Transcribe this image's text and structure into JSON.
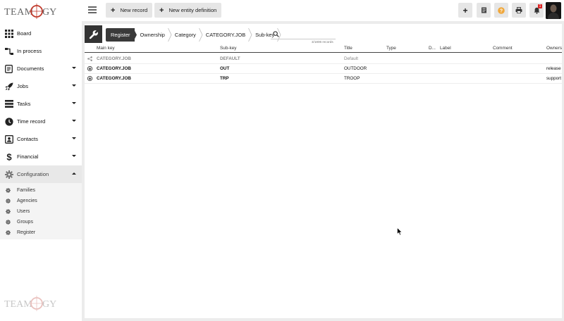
{
  "sidebar": {
    "items": [
      {
        "label": "Board",
        "icon": "grid-icon",
        "caret": ""
      },
      {
        "label": "In process",
        "icon": "flow-icon",
        "caret": ""
      },
      {
        "label": "Documents",
        "icon": "document-icon",
        "caret": "down"
      },
      {
        "label": "Jobs",
        "icon": "rocket-icon",
        "caret": "down"
      },
      {
        "label": "Tasks",
        "icon": "tasks-icon",
        "caret": "down"
      },
      {
        "label": "Time record",
        "icon": "clock-icon",
        "caret": "down"
      },
      {
        "label": "Contacts",
        "icon": "contacts-icon",
        "caret": "down"
      },
      {
        "label": "Financial",
        "icon": "dollar-icon",
        "caret": "down"
      },
      {
        "label": "Configuration",
        "icon": "gear-icon",
        "caret": "up"
      }
    ],
    "sub_items": [
      "Families",
      "Agencies",
      "Users",
      "Groups",
      "Register"
    ]
  },
  "toolbar": {
    "new_record": "New record",
    "new_entity": "New entity definition",
    "notification_count": "1"
  },
  "breadcrumbs": [
    "Register",
    "Ownership",
    "Category",
    "CATEGORY.JOB",
    "Sub-key"
  ],
  "search": {
    "placeholder": "",
    "count_text": "3/1806 records"
  },
  "table": {
    "headers": [
      "Main key",
      "Sub-key",
      "Title",
      "Type",
      "D...",
      "Label",
      "Comment",
      "Owners"
    ],
    "rows": [
      {
        "icon": "share-icon",
        "main_key": "CATEGORY.JOB",
        "sub_key": "DEFAULT",
        "title": "Default",
        "type": "",
        "d": "",
        "label": "",
        "comment": "",
        "owners": ""
      },
      {
        "icon": "lock-icon",
        "main_key": "CATEGORY.JOB",
        "sub_key": "OUT",
        "title": "OUTDOOR",
        "type": "",
        "d": "",
        "label": "",
        "comment": "",
        "owners": "release"
      },
      {
        "icon": "lock-icon",
        "main_key": "CATEGORY.JOB",
        "sub_key": "TRP",
        "title": "TROOP",
        "type": "",
        "d": "",
        "label": "",
        "comment": "",
        "owners": "support"
      }
    ]
  },
  "colors": {
    "accent_orange": "#f0a83c",
    "dark_tile": "#333333",
    "badge_red": "#dd2222"
  }
}
